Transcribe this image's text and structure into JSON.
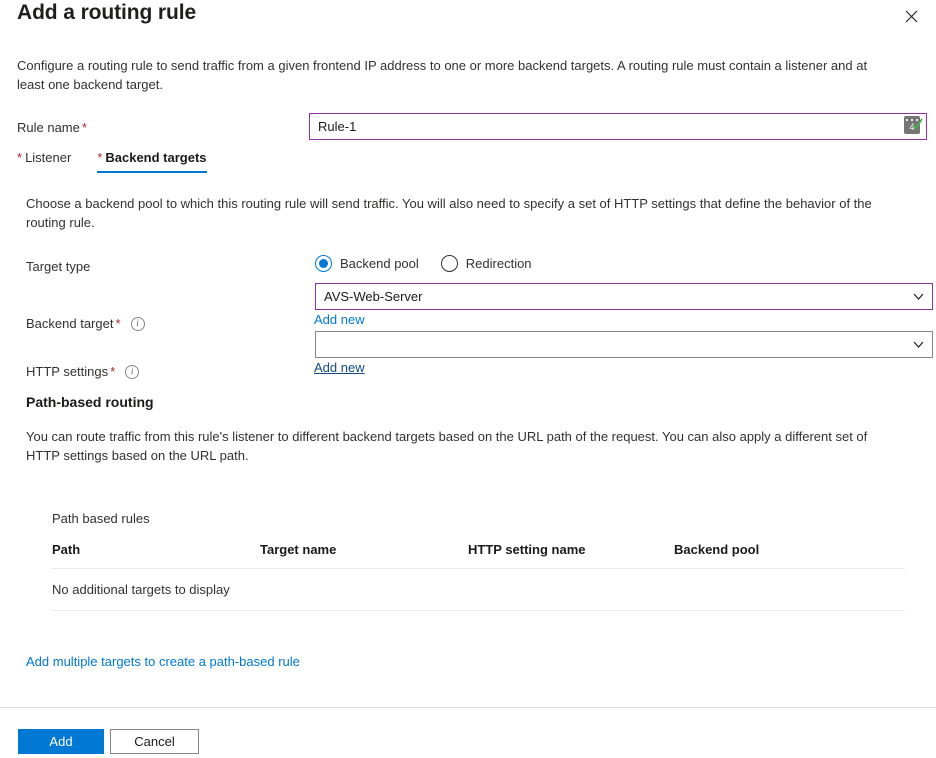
{
  "header": {
    "title": "Add a routing rule",
    "close_label": "Close"
  },
  "intro": "Configure a routing rule to send traffic from a given frontend IP address to one or more backend targets. A routing rule must contain a listener and at least one backend target.",
  "rule_name": {
    "label": "Rule name",
    "required_marker": "*",
    "value": "Rule-1",
    "placeholder": "",
    "badge_number": "4"
  },
  "tabs": [
    {
      "required_marker": "*",
      "label": "Listener",
      "active": false
    },
    {
      "required_marker": "*",
      "label": "Backend targets",
      "active": true
    }
  ],
  "backend_targets": {
    "description": "Choose a backend pool to which this routing rule will send traffic. You will also need to specify a set of HTTP settings that define the behavior of the routing rule.",
    "target_type": {
      "label": "Target type",
      "options": [
        {
          "label": "Backend pool",
          "selected": true
        },
        {
          "label": "Redirection",
          "selected": false
        }
      ]
    },
    "backend_target": {
      "label": "Backend target",
      "required_marker": "*",
      "info_glyph": "i",
      "value": "AVS-Web-Server",
      "add_new_label": "Add new"
    },
    "http_settings": {
      "label": "HTTP settings",
      "required_marker": "*",
      "info_glyph": "i",
      "value": "",
      "add_new_label": "Add new"
    }
  },
  "path_based_routing": {
    "title": "Path-based routing",
    "description": "You can route traffic from this rule's listener to different backend targets based on the URL path of the request. You can also apply a different set of HTTP settings based on the URL path.",
    "table_title": "Path based rules",
    "columns": [
      "Path",
      "Target name",
      "HTTP setting name",
      "Backend pool"
    ],
    "rows": [],
    "empty_message": "No additional targets to display",
    "add_multiple_link": "Add multiple targets to create a path-based rule"
  },
  "footer": {
    "primary_button": "Add",
    "secondary_button": "Cancel"
  },
  "colors": {
    "accent": "#0078d4",
    "required": "#a4262c",
    "focus_border": "#9230a8",
    "link": "#0078d4",
    "link_visited": "#134a86",
    "border": "#8a8886",
    "divider": "#edebe9"
  }
}
